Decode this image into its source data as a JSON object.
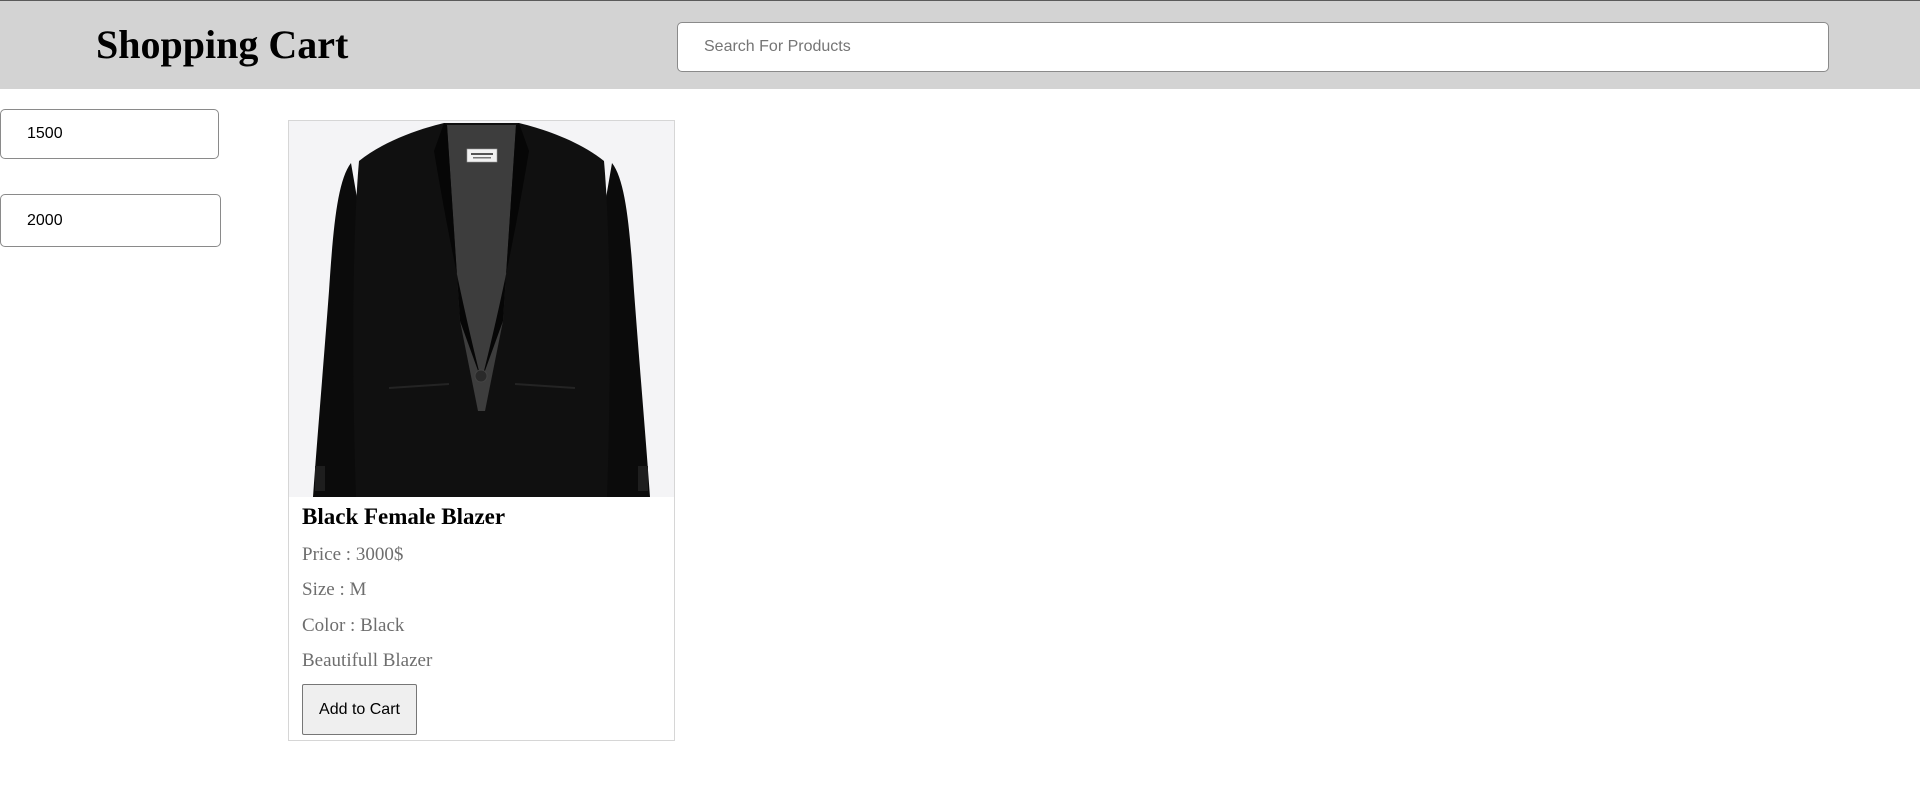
{
  "header": {
    "title": "Shopping Cart",
    "search_placeholder": "Search For Products",
    "search_value": ""
  },
  "filters": {
    "min_price": "1500",
    "max_price": "2000"
  },
  "products": [
    {
      "name": "Black Female Blazer",
      "price_label": "Price : ",
      "price": "3000$",
      "size_label": "Size : ",
      "size": "M",
      "color_label": "Color : ",
      "color": "Black",
      "description": "Beautifull Blazer",
      "add_to_cart_label": "Add to Cart",
      "image_icon": "black-blazer-image"
    }
  ],
  "colors": {
    "header_bg": "#d3d3d3",
    "card_border": "#d6d6d6",
    "meta_text": "#6e6e6e"
  }
}
